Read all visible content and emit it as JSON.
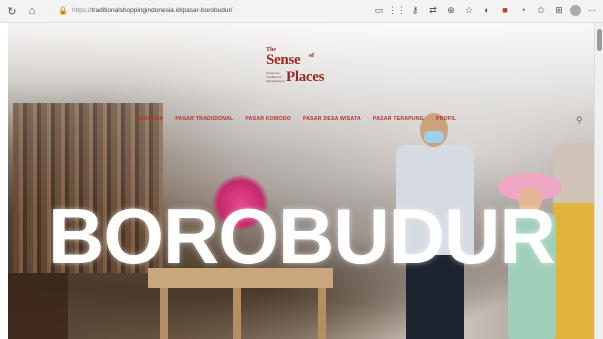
{
  "browser": {
    "url_protocol": "https://",
    "url_host": "traditionalshoppingindonesia.id",
    "url_path": "/pasar-borobudur/",
    "icons": [
      "refresh-icon",
      "home-icon",
      "lock-icon",
      "tab-icon",
      "grid-icon",
      "key-icon",
      "translate-icon",
      "zoom-icon",
      "star-icon",
      "red-extension-icon",
      "sync-icon",
      "favorites-icon",
      "collections-icon",
      "profile-icon",
      "more-icon"
    ]
  },
  "site": {
    "logo": {
      "the": "The",
      "sense": "Sense",
      "of": "of",
      "places": "Places",
      "sub": "Indonesia Traditional Marketplaces"
    },
    "nav": [
      {
        "label": "BERANDA"
      },
      {
        "label": "PASAR TRADISIONAL"
      },
      {
        "label": "PASAR KOMODO"
      },
      {
        "label": "PASAR DESA WISATA"
      },
      {
        "label": "PASAR TERAPUNG"
      },
      {
        "label": "PROFIL"
      }
    ],
    "hero_title": "BOROBUDUR"
  },
  "colors": {
    "brand_red": "#b3322a",
    "hero_text": "#ffffff"
  }
}
